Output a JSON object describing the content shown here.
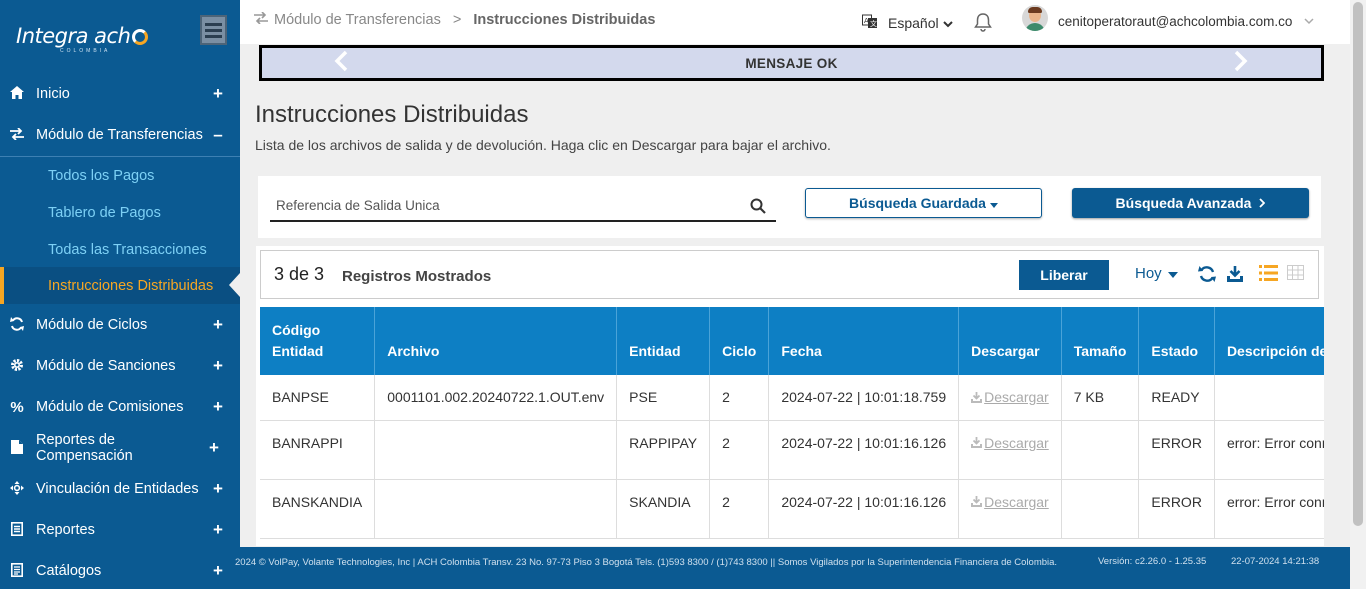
{
  "app": {
    "logo_text": "Integraach",
    "logo_sub": "COLOMBIA"
  },
  "sidebar": {
    "items": [
      {
        "label": "Inicio",
        "icon": "home-icon",
        "toggle": "+"
      },
      {
        "label": "Módulo de Transferencias",
        "icon": "transfer-icon",
        "toggle": "–"
      },
      {
        "label": "Módulo de Ciclos",
        "icon": "cycle-icon",
        "toggle": "+"
      },
      {
        "label": "Módulo de Sanciones",
        "icon": "gear-icon",
        "toggle": "+"
      },
      {
        "label": "Módulo de Comisiones",
        "icon": "percent-icon",
        "toggle": "+"
      },
      {
        "label": "Reportes de Compensación",
        "icon": "file-icon",
        "toggle": "+"
      },
      {
        "label": "Vinculación de Entidades",
        "icon": "link-icon",
        "toggle": "+"
      },
      {
        "label": "Reportes",
        "icon": "report-icon",
        "toggle": "+"
      },
      {
        "label": "Catálogos",
        "icon": "catalog-icon",
        "toggle": "+"
      }
    ],
    "subitems": [
      {
        "label": "Todos los Pagos"
      },
      {
        "label": "Tablero de Pagos"
      },
      {
        "label": "Todas las Transacciones"
      },
      {
        "label": "Instrucciones Distribuidas",
        "active": true
      }
    ]
  },
  "topbar": {
    "breadcrumb_parent": "Módulo de Transferencias",
    "breadcrumb_sep": ">",
    "breadcrumb_current": "Instrucciones Distribuidas",
    "language": "Español",
    "user_email": "cenitoperatoraut@achcolombia.com.co"
  },
  "banner": {
    "message": "MENSAJE OK"
  },
  "page": {
    "title": "Instrucciones Distribuidas",
    "subtitle": "Lista de los archivos de salida y de devolución. Haga clic en Descargar para bajar el archivo."
  },
  "search": {
    "placeholder": "Referencia de Salida Unica",
    "saved_label": "Búsqueda Guardada",
    "advanced_label": "Búsqueda Avanzada"
  },
  "records": {
    "count": "3 de 3",
    "label": "Registros Mostrados",
    "release_label": "Liberar",
    "period": "Hoy"
  },
  "table": {
    "headers": [
      "Código Entidad",
      "Archivo",
      "Entidad",
      "Ciclo",
      "Fecha",
      "Descargar",
      "Tamaño",
      "Estado",
      "Descripción del Estado"
    ],
    "rows": [
      {
        "codigo": "BANPSE",
        "archivo": "0001101.002.20240722.1.OUT.env",
        "entidad": "PSE",
        "ciclo": "2",
        "fecha": "2024-07-22 | 10:01:18.759",
        "descargar": "Descargar",
        "tamano": "7 KB",
        "estado": "READY",
        "descripcion": ""
      },
      {
        "codigo": "BANRAPPI",
        "archivo": "",
        "entidad": "RAPPIPAY",
        "ciclo": "2",
        "fecha": "2024-07-22 | 10:01:16.126",
        "descargar": "Descargar",
        "tamano": "",
        "estado": "ERROR",
        "descripcion": "error: Error connecting t"
      },
      {
        "codigo": "BANSKANDIA",
        "archivo": "",
        "entidad": "SKANDIA",
        "ciclo": "2",
        "fecha": "2024-07-22 | 10:01:16.126",
        "descargar": "Descargar",
        "tamano": "",
        "estado": "ERROR",
        "descripcion": "error: Error connecting t"
      }
    ]
  },
  "footer": {
    "text": "2024 © VolPay, Volante Technologies, Inc | ACH Colombia Transv. 23 No. 97-73 Piso 3 Bogotá Tels. (1)593 8300 / (1)743 8300 || Somos Vigilados por la Superintendencia Financiera de Colombia.",
    "version": "Versión: c2.26.0 - 1.25.35",
    "datetime": "22-07-2024 14:21:38"
  },
  "colors": {
    "sidebar_bg": "#0b5a92",
    "accent": "#f6a623",
    "table_header": "#0d7fc4",
    "submenu_text": "#7dd0f5"
  }
}
